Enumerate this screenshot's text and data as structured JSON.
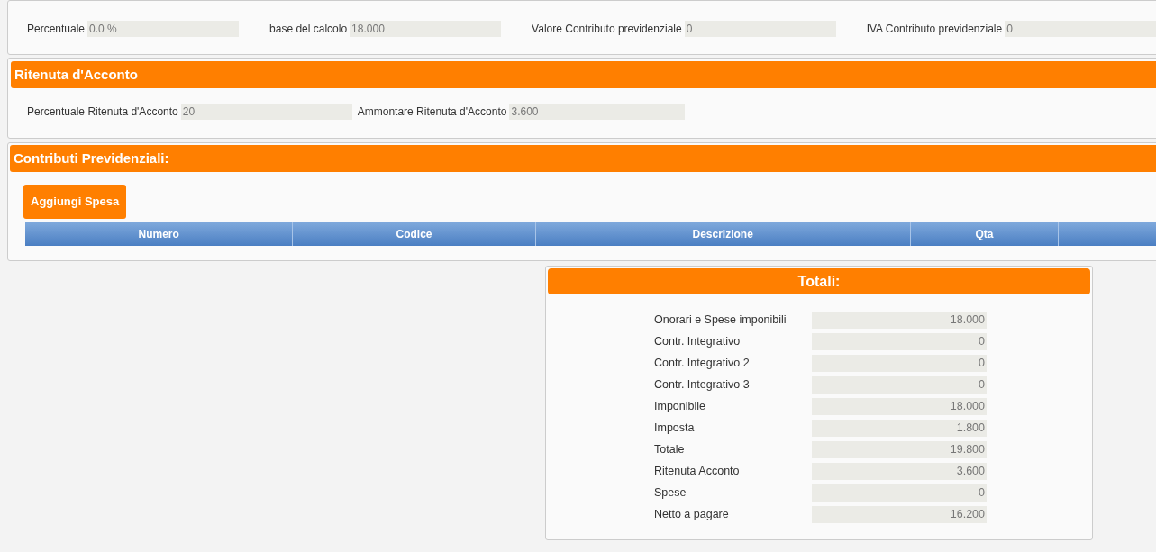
{
  "contributo_fields": [
    {
      "label": "Percentuale",
      "value": "0.0 %"
    },
    {
      "label": "base del calcolo",
      "value": "18.000"
    },
    {
      "label": "Valore Contributo previdenziale",
      "value": "0"
    },
    {
      "label": "IVA Contributo previdenziale",
      "value": "0"
    }
  ],
  "ritenuta": {
    "title": "Ritenuta d'Acconto",
    "fields": [
      {
        "label": "Percentuale Ritenuta d'Acconto",
        "value": "20"
      },
      {
        "label": "Ammontare Ritenuta d'Acconto",
        "value": "3.600"
      }
    ]
  },
  "contributi": {
    "title": "Contributi Previdenziali:",
    "add_button": "Aggiungi Spesa",
    "table": {
      "columns": [
        "Numero",
        "Codice",
        "Descrizione",
        "Qta"
      ]
    }
  },
  "totali": {
    "title": "Totali:",
    "rows": [
      {
        "label": "Onorari e Spese imponibili",
        "value": "18.000"
      },
      {
        "label": "Contr. Integrativo",
        "value": "0"
      },
      {
        "label": "Contr. Integrativo 2",
        "value": "0"
      },
      {
        "label": "Contr. Integrativo 3",
        "value": "0"
      },
      {
        "label": "Imponibile",
        "value": "18.000"
      },
      {
        "label": "Imposta",
        "value": "1.800"
      },
      {
        "label": "Totale",
        "value": "19.800"
      },
      {
        "label": "Ritenuta Acconto",
        "value": "3.600"
      },
      {
        "label": "Spese",
        "value": "0"
      },
      {
        "label": "Netto a pagare",
        "value": "16.200"
      }
    ]
  }
}
